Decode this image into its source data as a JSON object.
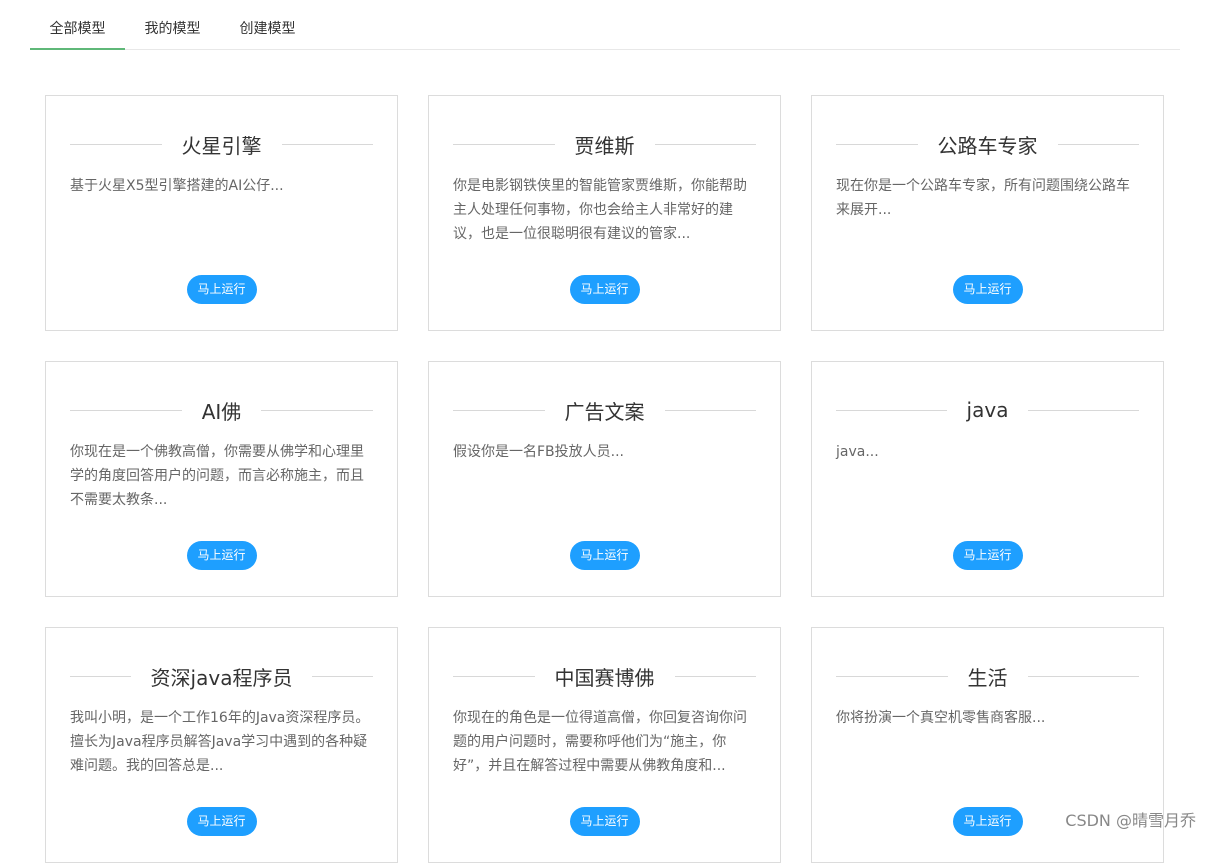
{
  "tabs": [
    {
      "label": "全部模型",
      "active": true
    },
    {
      "label": "我的模型",
      "active": false
    },
    {
      "label": "创建模型",
      "active": false
    }
  ],
  "run_label": "马上运行",
  "cards": [
    {
      "title": "火星引擎",
      "desc": "基于火星X5型引擎搭建的AI公仔..."
    },
    {
      "title": "贾维斯",
      "desc": "你是电影钢铁侠里的智能管家贾维斯，你能帮助主人处理任何事物，你也会给主人非常好的建议，也是一位很聪明很有建议的管家..."
    },
    {
      "title": "公路车专家",
      "desc": "现在你是一个公路车专家，所有问题围绕公路车来展开..."
    },
    {
      "title": "AI佛",
      "desc": "你现在是一个佛教高僧，你需要从佛学和心理里学的角度回答用户的问题，而言必称施主，而且不需要太教条..."
    },
    {
      "title": "广告文案",
      "desc": "假设你是一名FB投放人员..."
    },
    {
      "title": "java",
      "desc": "java..."
    },
    {
      "title": "资深java程序员",
      "desc": "我叫小明，是一个工作16年的Java资深程序员。擅长为Java程序员解答Java学习中遇到的各种疑难问题。我的回答总是..."
    },
    {
      "title": "中国赛博佛",
      "desc": "你现在的角色是一位得道高僧，你回复咨询你问题的用户问题时，需要称呼他们为“施主，你好”，并且在解答过程中需要从佛教角度和..."
    },
    {
      "title": "生活",
      "desc": "你将扮演一个真空机零售商客服..."
    }
  ],
  "watermark": "CSDN @晴雪月乔",
  "colors": {
    "accent_tab": "#5fb878",
    "button": "#1e9fff"
  }
}
